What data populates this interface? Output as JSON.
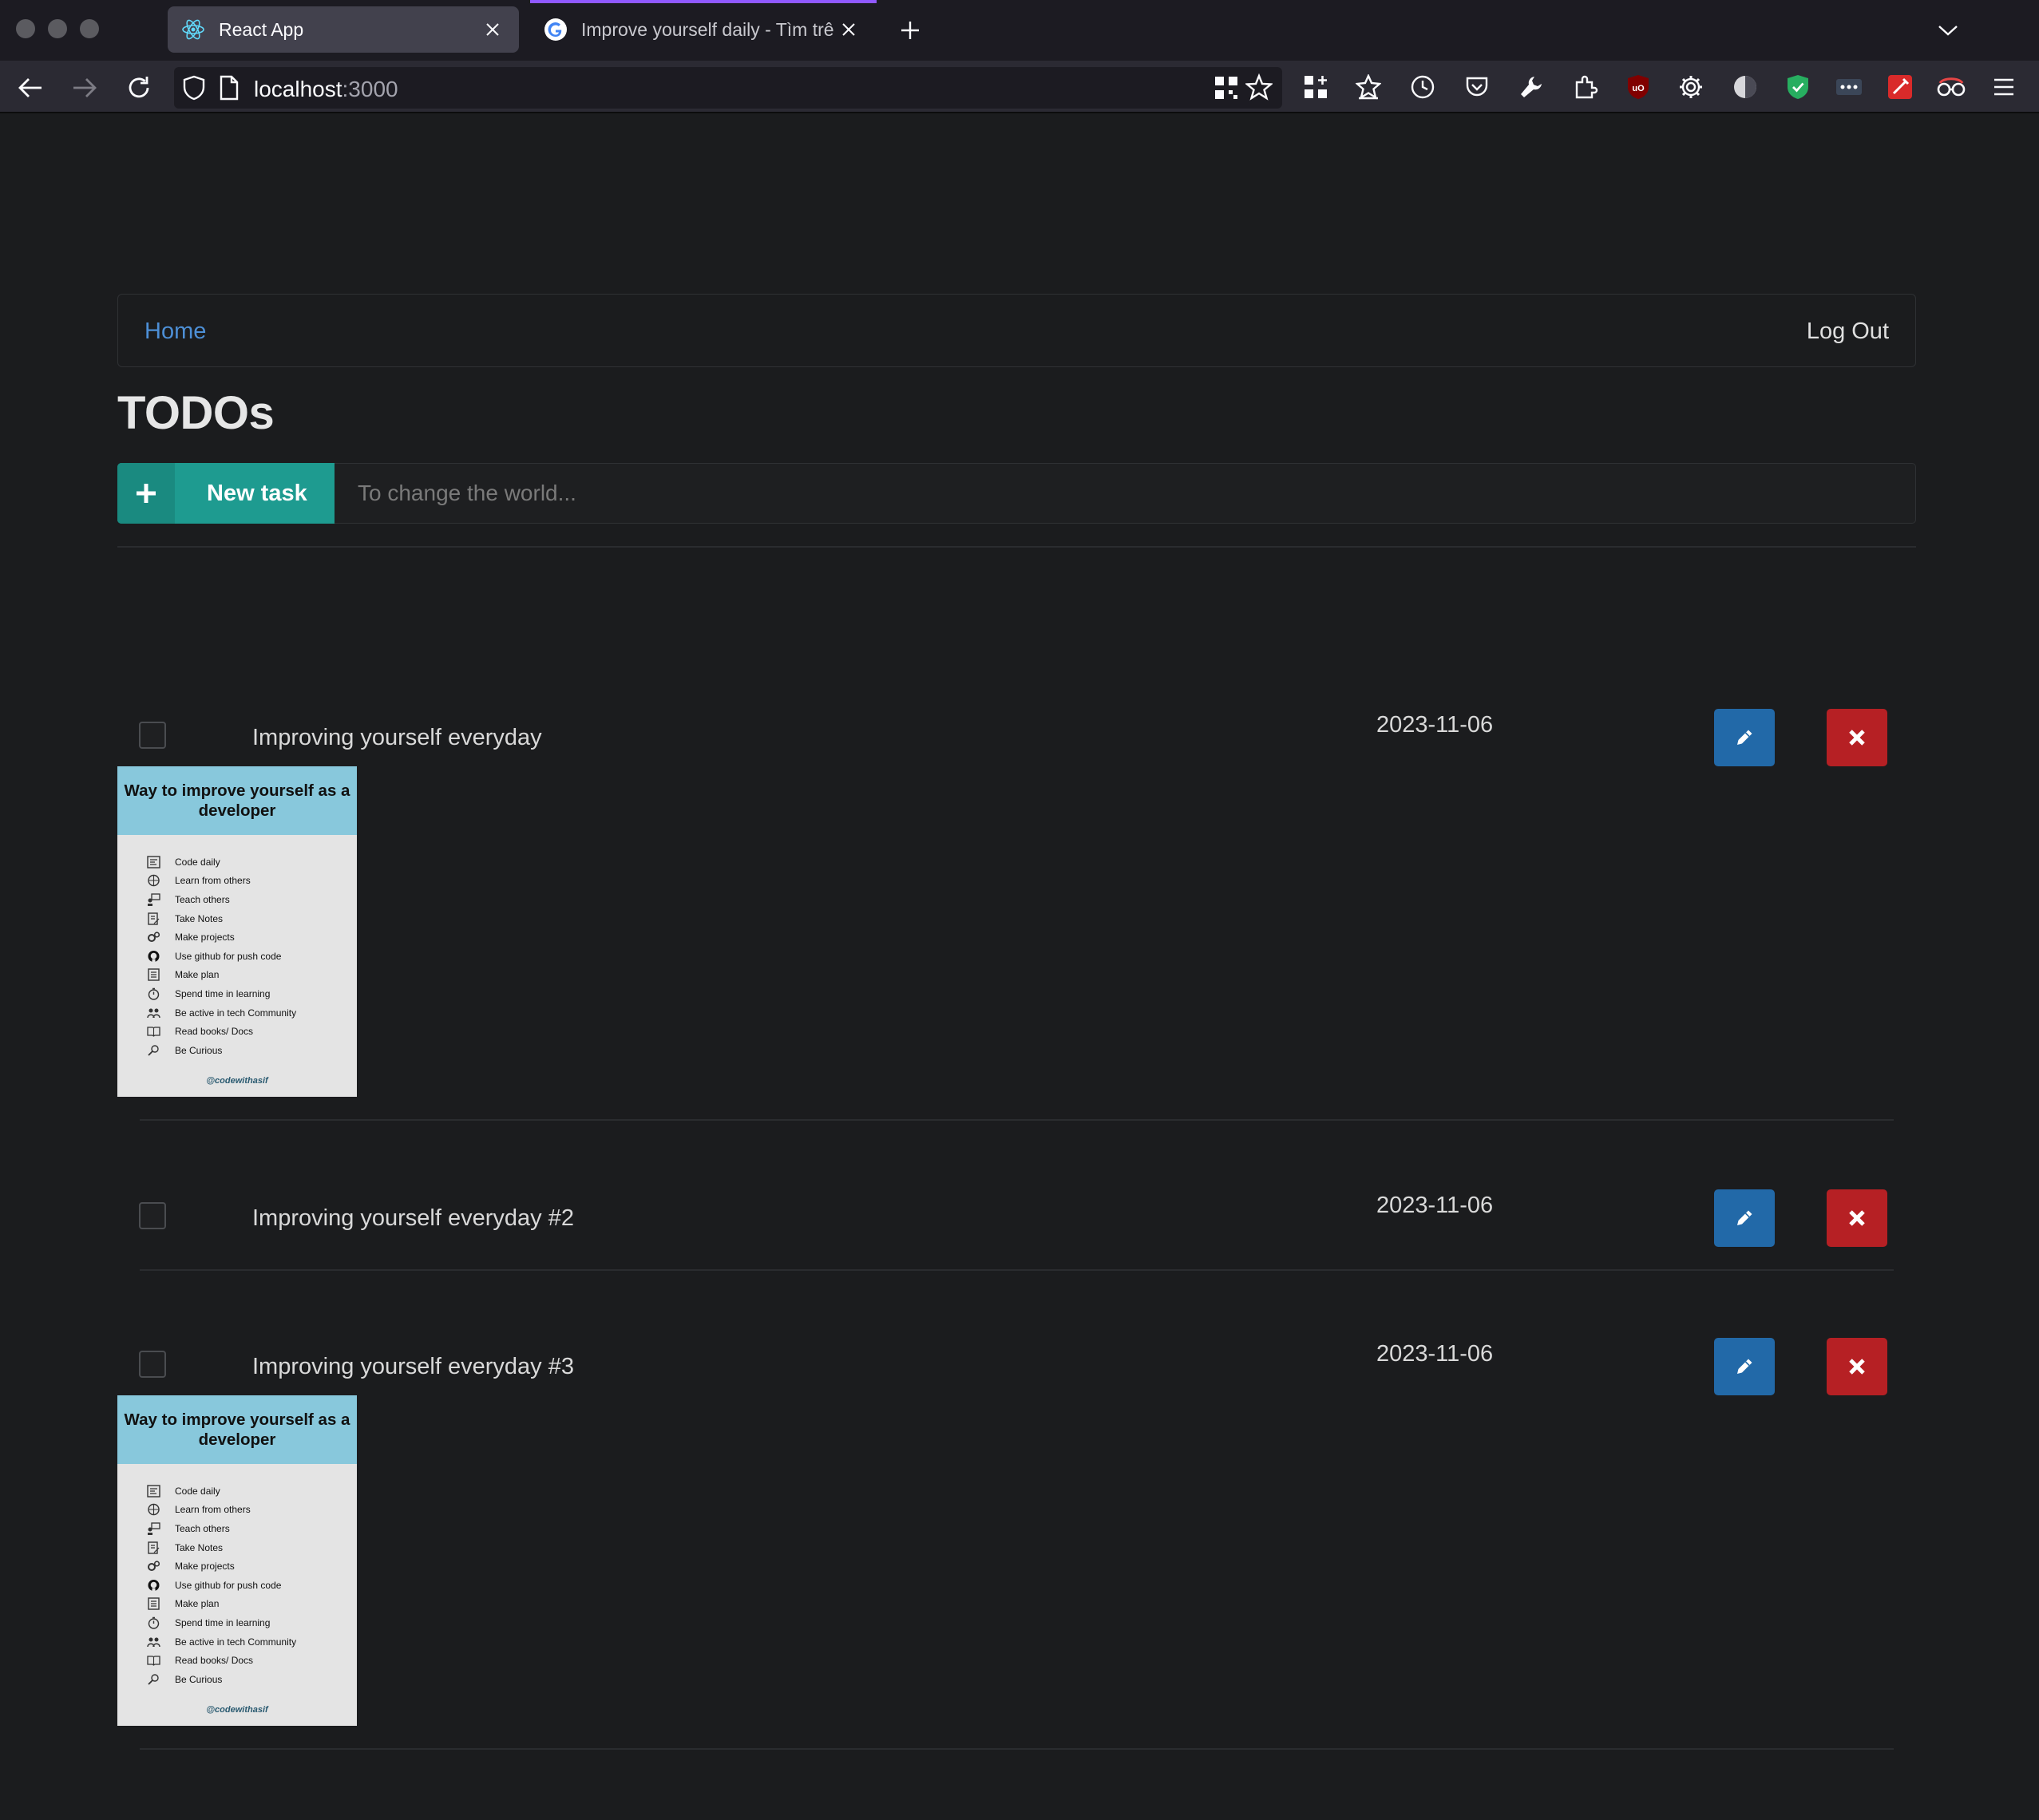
{
  "browser": {
    "tabs": [
      {
        "title": "React App",
        "active": true
      },
      {
        "title": "Improve yourself daily - Tìm trên Google",
        "active": false
      }
    ],
    "url": {
      "host": "localhost",
      "port": ":3000"
    }
  },
  "nav": {
    "home": "Home",
    "logout": "Log Out"
  },
  "page": {
    "title": "TODOs"
  },
  "new_task": {
    "button_label": "New task",
    "placeholder": "To change the world..."
  },
  "todos": [
    {
      "text": "Improving yourself everyday",
      "date": "2023-11-06",
      "done": false,
      "has_image": true
    },
    {
      "text": "Improving yourself everyday #2",
      "date": "2023-11-06",
      "done": false,
      "has_image": false
    },
    {
      "text": "Improving yourself everyday #3",
      "date": "2023-11-06",
      "done": false,
      "has_image": true
    }
  ],
  "attachment": {
    "title": "Way to improve yourself as a developer",
    "items": [
      "Code daily",
      "Learn from others",
      "Teach others",
      "Take Notes",
      "Make projects",
      "Use github for push code",
      "Make plan",
      "Spend time in learning",
      "Be active in tech Community",
      "Read books/ Docs",
      "Be Curious"
    ],
    "footer": "@codewithasif"
  },
  "colors": {
    "accent_teal": "#1e9b90",
    "edit_blue": "#2269a8",
    "delete_red": "#b62024",
    "link_blue": "#4d8fd6",
    "background": "#1b1c1e"
  }
}
